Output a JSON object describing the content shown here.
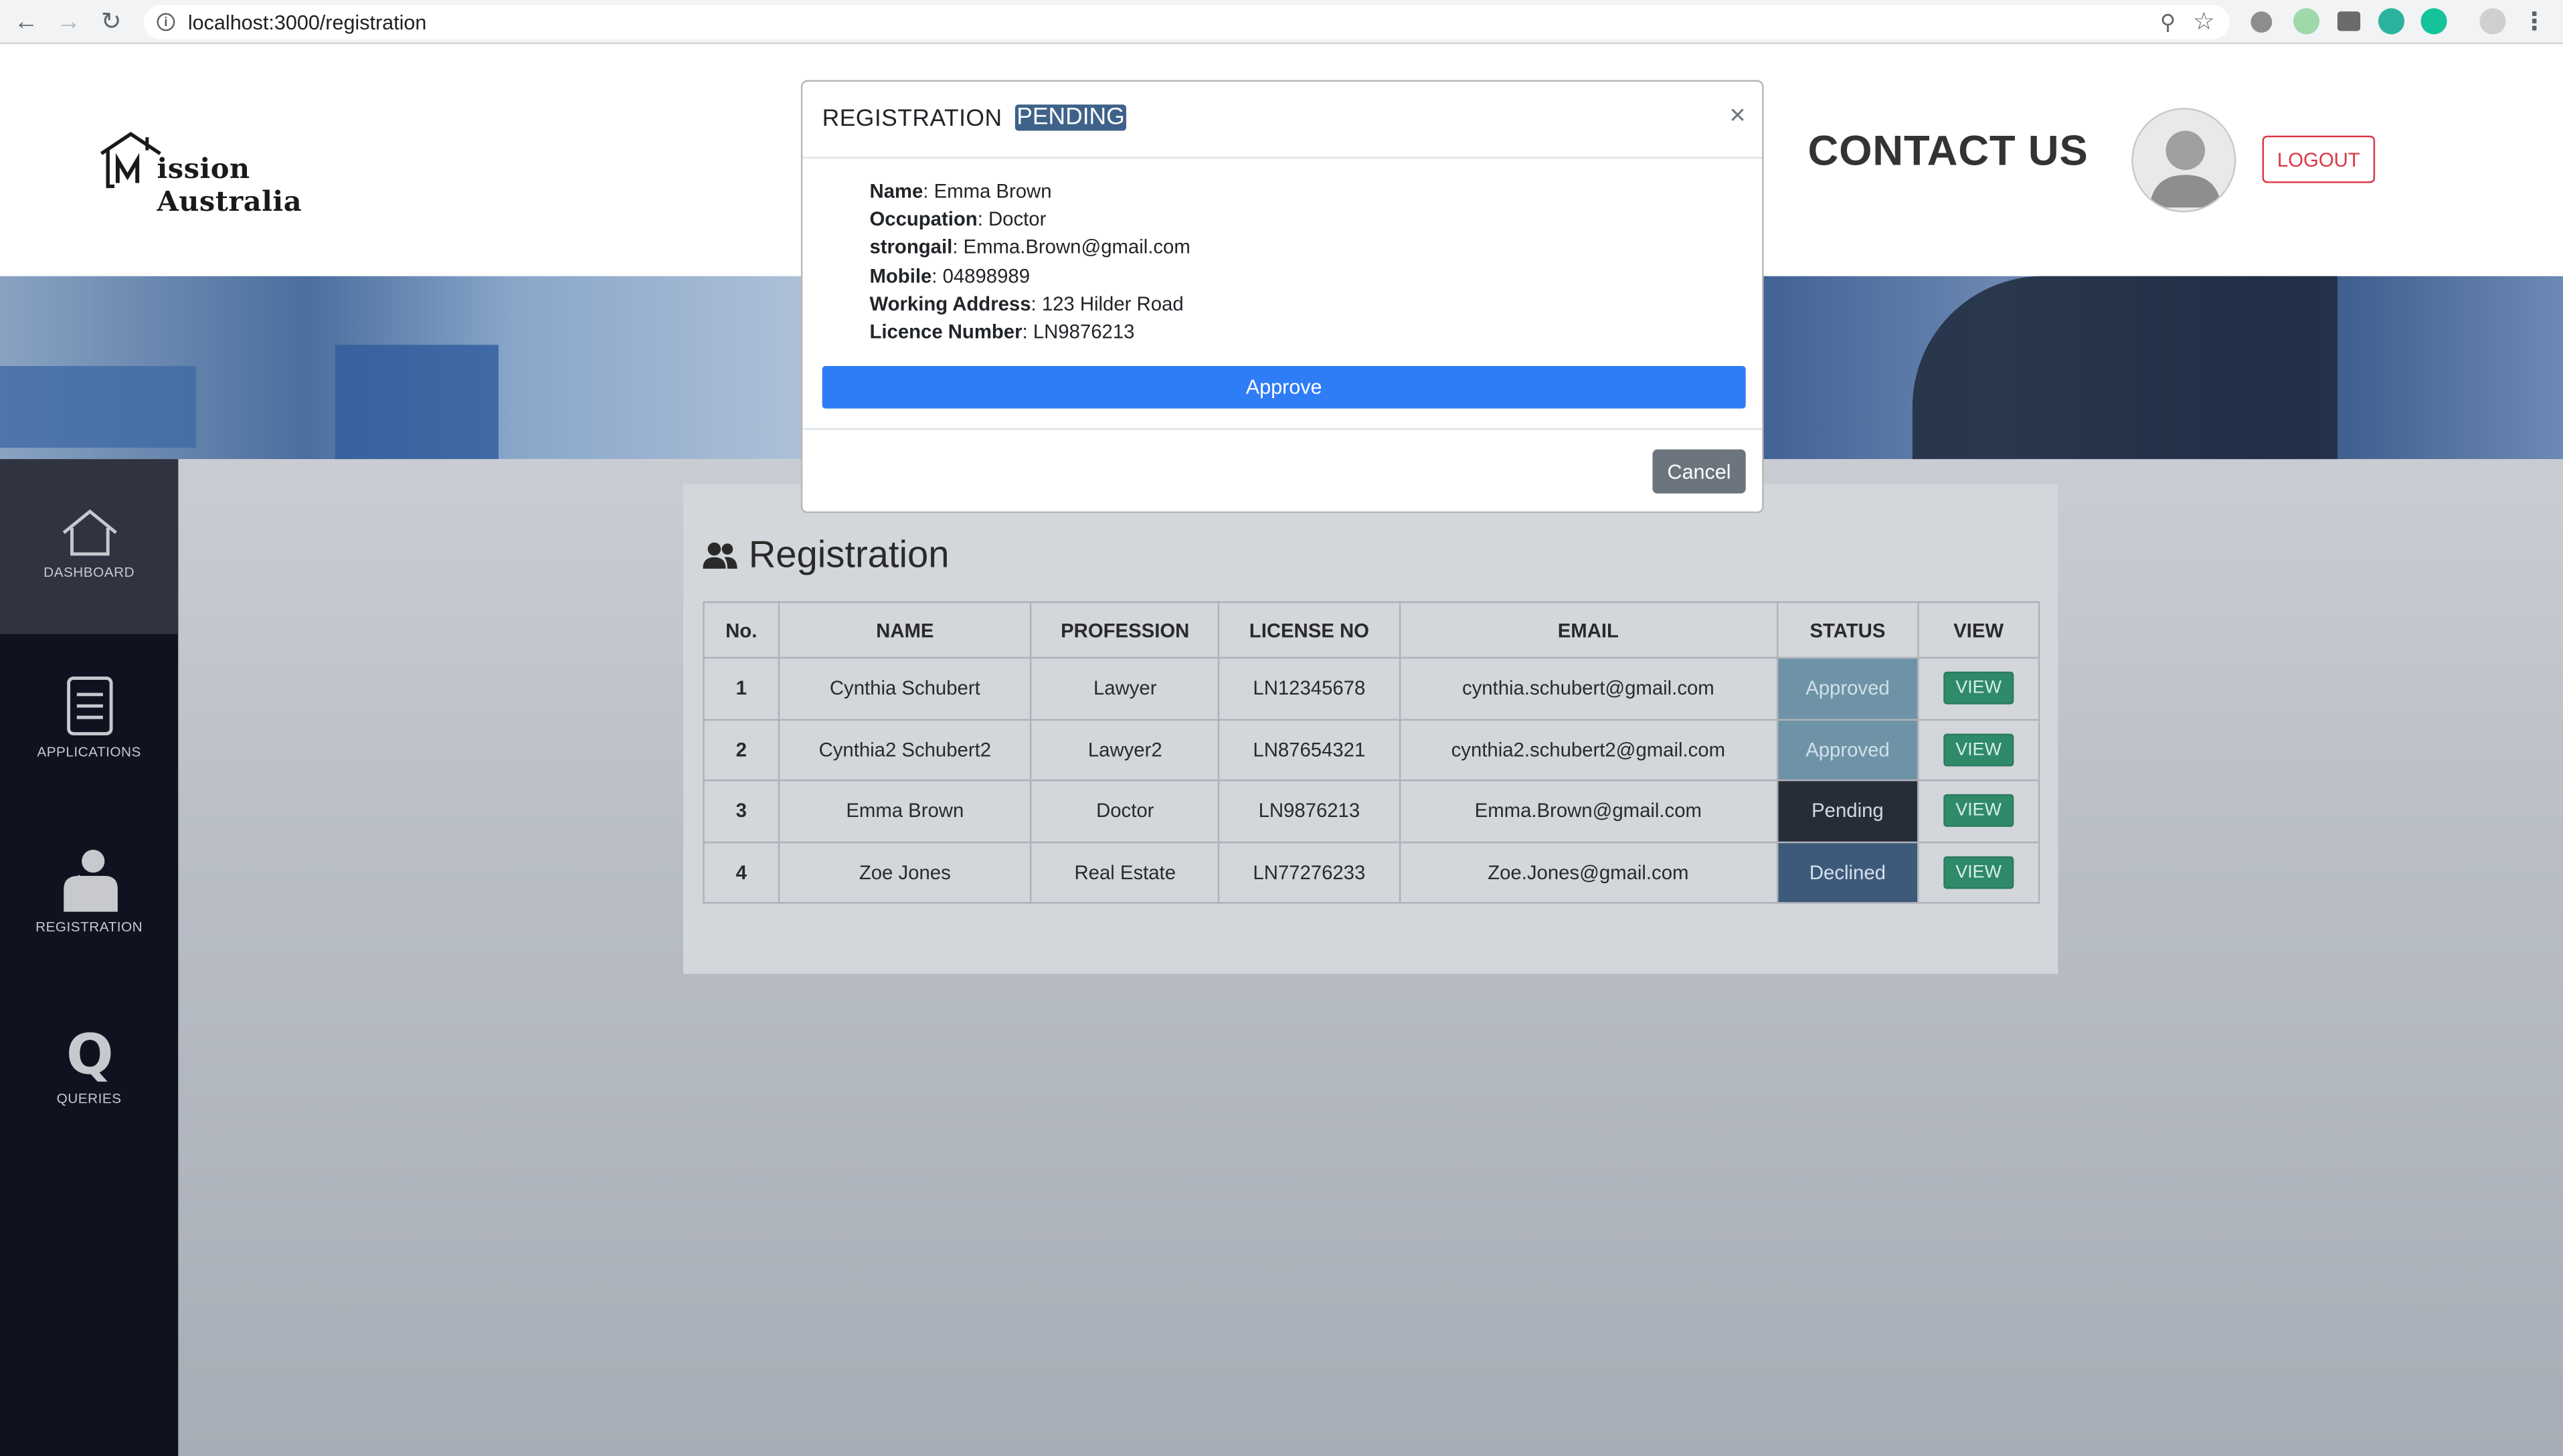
{
  "browser": {
    "url": "localhost:3000/registration"
  },
  "header": {
    "logo_text": "ission Australia",
    "contact_label": "CONTACT US",
    "logout_label": "LOGOUT"
  },
  "sidebar": {
    "items": [
      {
        "label": "DASHBOARD",
        "icon": "home-icon",
        "active": true
      },
      {
        "label": "APPLICATIONS",
        "icon": "document-icon",
        "active": false
      },
      {
        "label": "REGISTRATION",
        "icon": "person-icon",
        "active": false
      },
      {
        "label": "QUERIES",
        "icon": "q-icon",
        "active": false
      }
    ]
  },
  "registration": {
    "title": "Registration",
    "columns": [
      "No.",
      "NAME",
      "PROFESSION",
      "LICENSE NO",
      "EMAIL",
      "STATUS",
      "VIEW"
    ],
    "rows": [
      {
        "no": "1",
        "name": "Cynthia Schubert",
        "profession": "Lawyer",
        "license": "LN12345678",
        "email": "cynthia.schubert@gmail.com",
        "status": "Approved",
        "view": "VIEW"
      },
      {
        "no": "2",
        "name": "Cynthia2 Schubert2",
        "profession": "Lawyer2",
        "license": "LN87654321",
        "email": "cynthia2.schubert2@gmail.com",
        "status": "Approved",
        "view": "VIEW"
      },
      {
        "no": "3",
        "name": "Emma Brown",
        "profession": "Doctor",
        "license": "LN9876213",
        "email": "Emma.Brown@gmail.com",
        "status": "Pending",
        "view": "VIEW"
      },
      {
        "no": "4",
        "name": "Zoe Jones",
        "profession": "Real Estate",
        "license": "LN77276233",
        "email": "Zoe.Jones@gmail.com",
        "status": "Declined",
        "view": "VIEW"
      }
    ]
  },
  "modal": {
    "title": "REGISTRATION",
    "badge": "PENDING",
    "close": "×",
    "fields": [
      {
        "label": "Name",
        "value": "Emma Brown"
      },
      {
        "label": "Occupation",
        "value": "Doctor"
      },
      {
        "label": "strongail",
        "value": "Emma.Brown@gmail.com"
      },
      {
        "label": "Mobile",
        "value": "04898989"
      },
      {
        "label": "Working Address",
        "value": "123 Hilder Road"
      },
      {
        "label": "Licence Number",
        "value": "LN9876213"
      }
    ],
    "approve_label": "Approve",
    "cancel_label": "Cancel"
  },
  "colors": {
    "approve": "#2f7df6",
    "cancel": "#6c757d",
    "logout": "#dc3545",
    "badge": "#3e6289",
    "sidebar": "#10131f"
  }
}
